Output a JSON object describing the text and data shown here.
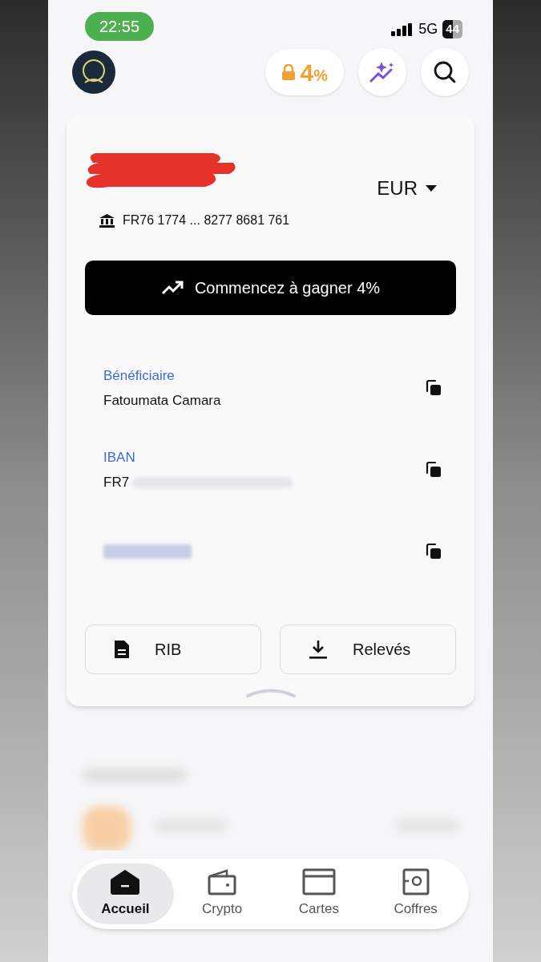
{
  "status_bar": {
    "time": "22:55",
    "network": "5G",
    "battery": "44"
  },
  "header": {
    "rate_badge": {
      "value": "4",
      "unit": "%"
    }
  },
  "account": {
    "currency": "EUR",
    "iban_short": "FR76 1774 ... 8277 8681 761",
    "promo_button": "Commencez à gagner 4%"
  },
  "details": [
    {
      "kind": "text",
      "label": "Bénéficiaire",
      "value": "Fatoumata Camara"
    },
    {
      "kind": "redacted",
      "label": "IBAN",
      "value": "FR7"
    },
    {
      "kind": "hidden"
    }
  ],
  "actions": [
    {
      "kind": "document",
      "label": "RIB"
    },
    {
      "kind": "download",
      "label": "Relevés"
    }
  ],
  "nav": [
    {
      "kind": "home",
      "label": "Accueil",
      "selected": true
    },
    {
      "kind": "wallet",
      "label": "Crypto",
      "selected": false
    },
    {
      "kind": "card",
      "label": "Cartes",
      "selected": false
    },
    {
      "kind": "safe",
      "label": "Coffres",
      "selected": false
    }
  ]
}
